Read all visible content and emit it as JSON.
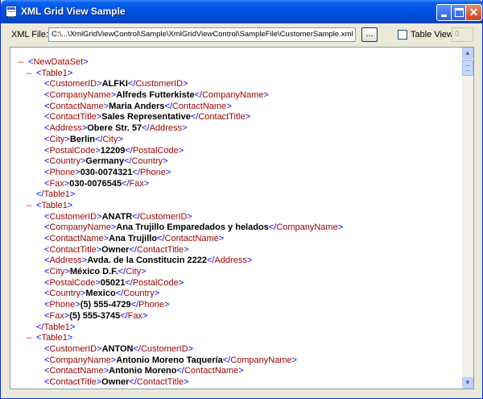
{
  "window": {
    "title": "XML Grid View Sample"
  },
  "toolbar": {
    "xml_file_label": "XML File:",
    "file_path": "C:\\...\\XmlGridViewControl\\Sample\\XmlGridViewControl\\SampleFile\\CustomerSample.xml",
    "browse_label": "...",
    "table_view_label": "Table View",
    "table_view_checked": false,
    "table_index": "0"
  },
  "xml": {
    "root": "NewDataSet",
    "records": [
      {
        "tag": "Table1",
        "fields": [
          {
            "tag": "CustomerID",
            "value": "ALFKI"
          },
          {
            "tag": "CompanyName",
            "value": "Alfreds Futterkiste"
          },
          {
            "tag": "ContactName",
            "value": "Maria Anders"
          },
          {
            "tag": "ContactTitle",
            "value": "Sales Representative"
          },
          {
            "tag": "Address",
            "value": "Obere Str. 57"
          },
          {
            "tag": "City",
            "value": "Berlin"
          },
          {
            "tag": "PostalCode",
            "value": "12209"
          },
          {
            "tag": "Country",
            "value": "Germany"
          },
          {
            "tag": "Phone",
            "value": "030-0074321"
          },
          {
            "tag": "Fax",
            "value": "030-0076545"
          }
        ]
      },
      {
        "tag": "Table1",
        "fields": [
          {
            "tag": "CustomerID",
            "value": "ANATR"
          },
          {
            "tag": "CompanyName",
            "value": "Ana Trujillo Emparedados y helados"
          },
          {
            "tag": "ContactName",
            "value": "Ana Trujillo"
          },
          {
            "tag": "ContactTitle",
            "value": "Owner"
          },
          {
            "tag": "Address",
            "value": "Avda. de la Constitucin 2222"
          },
          {
            "tag": "City",
            "value": "México D.F."
          },
          {
            "tag": "PostalCode",
            "value": "05021"
          },
          {
            "tag": "Country",
            "value": "Mexico"
          },
          {
            "tag": "Phone",
            "value": "(5) 555-4729"
          },
          {
            "tag": "Fax",
            "value": "(5) 555-3745"
          }
        ]
      },
      {
        "tag": "Table1",
        "fields": [
          {
            "tag": "CustomerID",
            "value": "ANTON"
          },
          {
            "tag": "CompanyName",
            "value": "Antonio Moreno Taquería"
          },
          {
            "tag": "ContactName",
            "value": "Antonio Moreno"
          },
          {
            "tag": "ContactTitle",
            "value": "Owner"
          }
        ]
      }
    ]
  },
  "colors": {
    "toggle": "#FF0000",
    "tag_name": "#990000",
    "bracket": "#0000FF",
    "value": "#000000",
    "title_bar": "#0055E5"
  }
}
